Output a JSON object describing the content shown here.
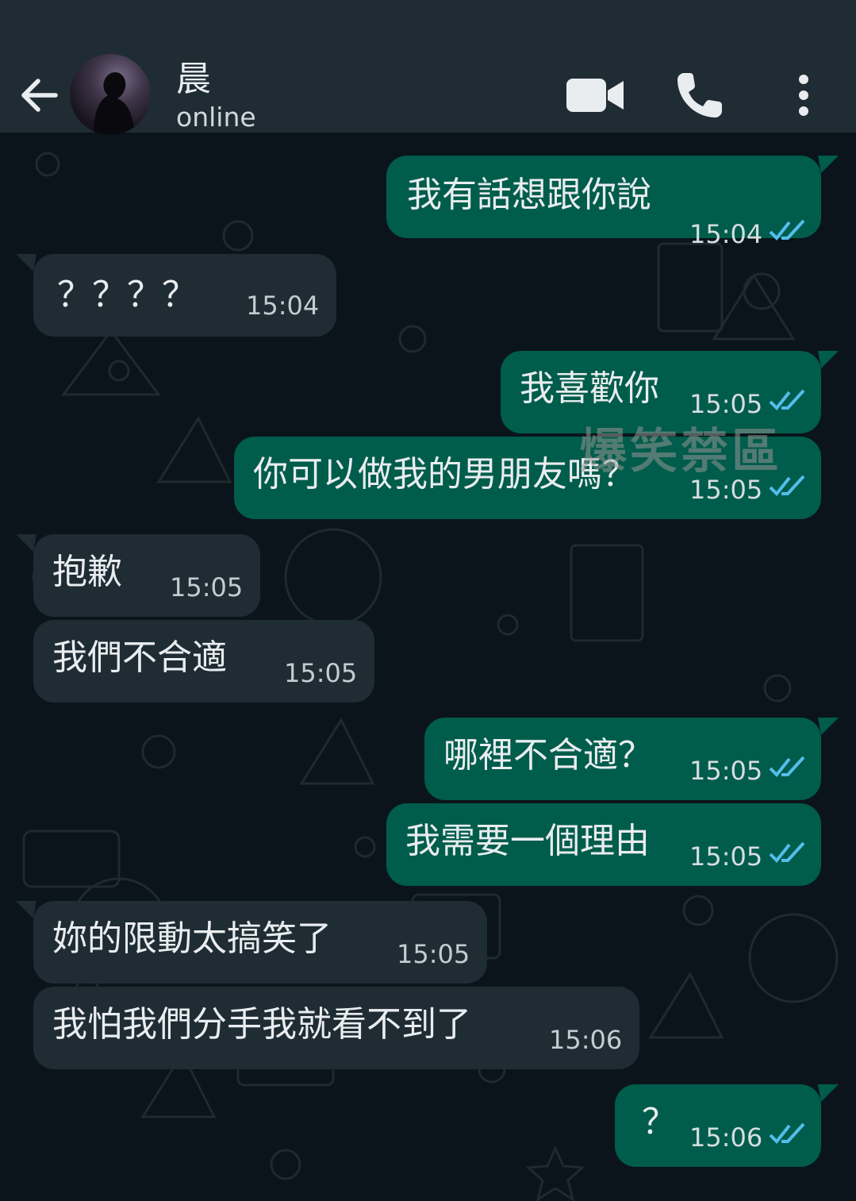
{
  "header": {
    "contact_name": "晨",
    "status": "online",
    "back_icon": "arrow-left-icon",
    "video_icon": "video-camera-icon",
    "call_icon": "phone-icon",
    "menu_icon": "more-vertical-icon"
  },
  "colors": {
    "header_bg": "#1f2c34",
    "chat_bg": "#0b141a",
    "outgoing_bubble": "#005c4b",
    "incoming_bubble": "#1f2c34",
    "read_tick": "#53bdeb"
  },
  "messages": [
    {
      "direction": "out",
      "text": "我有話想跟你說",
      "time": "15:04",
      "status": "read"
    },
    {
      "direction": "in",
      "text": "？？？？",
      "time": "15:04"
    },
    {
      "direction": "out",
      "text": "我喜歡你",
      "time": "15:05",
      "status": "read"
    },
    {
      "direction": "out",
      "text": "你可以做我的男朋友嗎？",
      "time": "15:05",
      "status": "read"
    },
    {
      "direction": "in",
      "text": "抱歉",
      "time": "15:05"
    },
    {
      "direction": "in",
      "text": "我們不合適",
      "time": "15:05"
    },
    {
      "direction": "out",
      "text": "哪裡不合適？",
      "time": "15:05",
      "status": "read"
    },
    {
      "direction": "out",
      "text": "我需要一個理由",
      "time": "15:05",
      "status": "read"
    },
    {
      "direction": "in",
      "text": "妳的限動太搞笑了",
      "time": "15:05"
    },
    {
      "direction": "in",
      "text": "我怕我們分手我就看不到了",
      "time": "15:06"
    },
    {
      "direction": "out",
      "text": "？",
      "time": "15:06",
      "status": "read"
    }
  ],
  "watermark": "爆笑禁區"
}
